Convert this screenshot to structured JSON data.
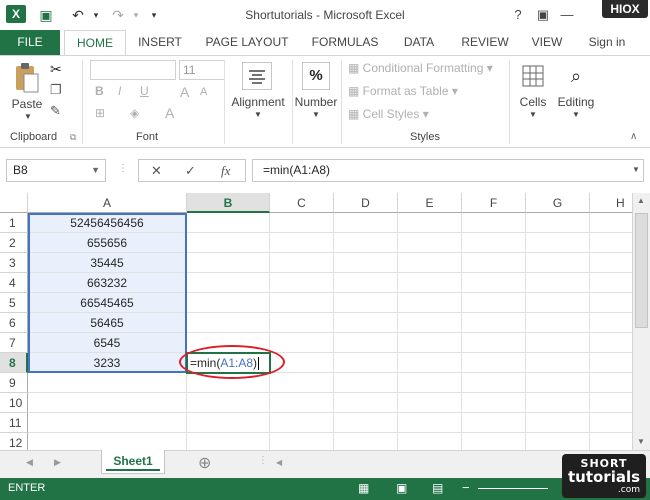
{
  "window": {
    "title": "Shortutorials - Microsoft Excel",
    "app_icon": "X",
    "watermark_top": "HIOX",
    "help": "?",
    "minimize": "—",
    "restore": "❐",
    "close": "✕"
  },
  "quick_access": {
    "save": "💾",
    "undo": "↶",
    "redo": "↷",
    "more": "▾"
  },
  "tabs": [
    "FILE",
    "HOME",
    "INSERT",
    "PAGE LAYOUT",
    "FORMULAS",
    "DATA",
    "REVIEW",
    "VIEW"
  ],
  "sign_in": "Sign in",
  "ribbon": {
    "clipboard": {
      "label": "Clipboard",
      "paste": "Paste"
    },
    "font": {
      "label": "Font",
      "name_value": "",
      "size_value": "11",
      "bold": "B",
      "italic": "I",
      "underline": "U",
      "grow": "A",
      "shrink": "A"
    },
    "alignment": "Alignment",
    "number": "Number",
    "number_icon": "%",
    "styles": {
      "label": "Styles",
      "conditional": "Conditional Formatting",
      "format_table": "Format as Table",
      "cell_styles": "Cell Styles"
    },
    "cells": "Cells",
    "editing": "Editing"
  },
  "formula_bar": {
    "name_box": "B8",
    "cancel": "✕",
    "enter": "✓",
    "fx": "fx",
    "formula": "=min(A1:A8)"
  },
  "grid": {
    "columns": [
      "A",
      "B",
      "C",
      "D",
      "E",
      "F",
      "G",
      "H"
    ],
    "rows": [
      "1",
      "2",
      "3",
      "4",
      "5",
      "6",
      "7",
      "8",
      "9",
      "10",
      "11",
      "12"
    ],
    "column_a": [
      "52456456456",
      "655656",
      "35445",
      "663232",
      "66545465",
      "56465",
      "6545",
      "3233"
    ],
    "active_cell_prefix": "=min(",
    "active_cell_ref": "A1:A8",
    "active_cell_suffix": ")",
    "colors": {
      "accent": "#217346",
      "range_highlight": "#eaf0fb",
      "annotation": "#d9202b",
      "ref_blue": "#4472c4"
    }
  },
  "sheets": {
    "active": "Sheet1",
    "add": "⊕"
  },
  "status": {
    "mode": "ENTER"
  },
  "watermark": {
    "line1": "SHORT",
    "line2": "tutorials",
    "line3": ".com"
  }
}
